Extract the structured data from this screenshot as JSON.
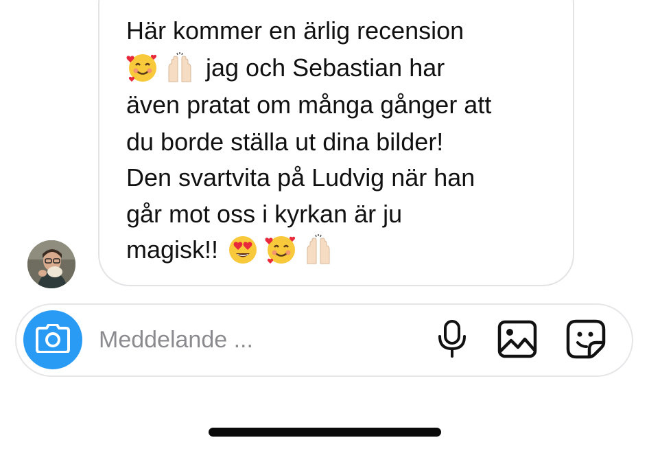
{
  "message": {
    "lines": [
      "Här kommer en ärlig recension",
      "jag och Sebastian har",
      "även pratat om många gånger att",
      "du borde ställa ut dina bilder!",
      "Den svartvita på Ludvig när han",
      "går mot oss i kyrkan är ju",
      "magisk!!"
    ],
    "emojis_line2": [
      "smiling-face-with-hearts",
      "raising-hands"
    ],
    "emojis_line7": [
      "heart-eyes",
      "smiling-face-with-hearts",
      "raising-hands"
    ]
  },
  "composer": {
    "placeholder": "Meddelande ...",
    "camera_icon": "camera-icon",
    "tools": [
      "microphone-icon",
      "gallery-icon",
      "sticker-icon"
    ]
  },
  "colors": {
    "camera_button": "#2a9bf5",
    "bubble_border": "#e3e3e6",
    "placeholder_text": "#8b8b8f"
  }
}
